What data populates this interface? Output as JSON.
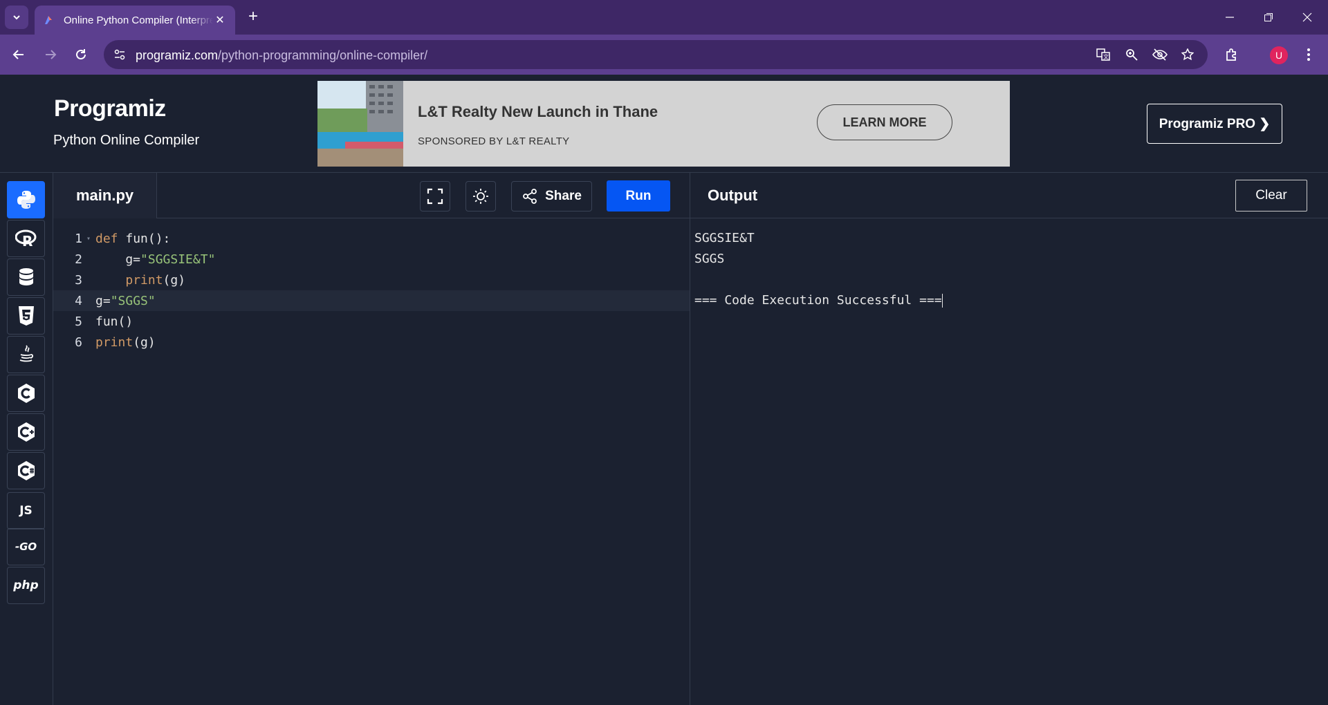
{
  "browser": {
    "tab_title": "Online Python Compiler (Interpreter)",
    "url_domain": "programiz.com",
    "url_path": "/python-programming/online-compiler/",
    "profile_initial": "U"
  },
  "site": {
    "logo": "Programiz",
    "subtitle": "Python Online Compiler",
    "pro_label": "Programiz PRO ❯"
  },
  "ad": {
    "title": "L&T Realty New Launch in Thane",
    "sponsor": "SPONSORED BY L&T REALTY",
    "button": "LEARN MORE"
  },
  "languages": [
    {
      "name": "python-lang",
      "label": ""
    },
    {
      "name": "r-lang",
      "label": "R"
    },
    {
      "name": "sql-lang",
      "label": ""
    },
    {
      "name": "html-lang",
      "label": "5"
    },
    {
      "name": "java-lang",
      "label": "☕"
    },
    {
      "name": "c-lang",
      "label": "C"
    },
    {
      "name": "cpp-lang",
      "label": "C+"
    },
    {
      "name": "csharp-lang",
      "label": "C#"
    },
    {
      "name": "js-lang",
      "label": "JS"
    },
    {
      "name": "go-lang",
      "label": "-GO"
    },
    {
      "name": "php-lang",
      "label": "php"
    }
  ],
  "editor": {
    "file_name": "main.py",
    "share_label": "Share",
    "run_label": "Run",
    "lines": [
      {
        "no": "1",
        "parts": [
          [
            "kw",
            "def"
          ],
          [
            "pn",
            " fun():"
          ]
        ]
      },
      {
        "no": "2",
        "parts": [
          [
            "pn",
            "    g="
          ],
          [
            "str",
            "\"SGGSIE&T\""
          ]
        ]
      },
      {
        "no": "3",
        "parts": [
          [
            "pn",
            "    "
          ],
          [
            "kw",
            "print"
          ],
          [
            "pn",
            "(g)"
          ]
        ]
      },
      {
        "no": "4",
        "parts": [
          [
            "pn",
            "g="
          ],
          [
            "str",
            "\"SGGS\""
          ]
        ]
      },
      {
        "no": "5",
        "parts": [
          [
            "pn",
            "fun()"
          ]
        ]
      },
      {
        "no": "6",
        "parts": [
          [
            "kw",
            "print"
          ],
          [
            "pn",
            "(g)"
          ]
        ]
      }
    ]
  },
  "output": {
    "title": "Output",
    "clear_label": "Clear",
    "lines": [
      "SGGSIE&T",
      "SGGS",
      "",
      "=== Code Execution Successful ==="
    ]
  },
  "colors": {
    "background": "#1b2130",
    "browser_frame": "#5c3f8f",
    "run_button": "#0556f3",
    "keyword": "#d19a66",
    "string": "#98c379"
  }
}
